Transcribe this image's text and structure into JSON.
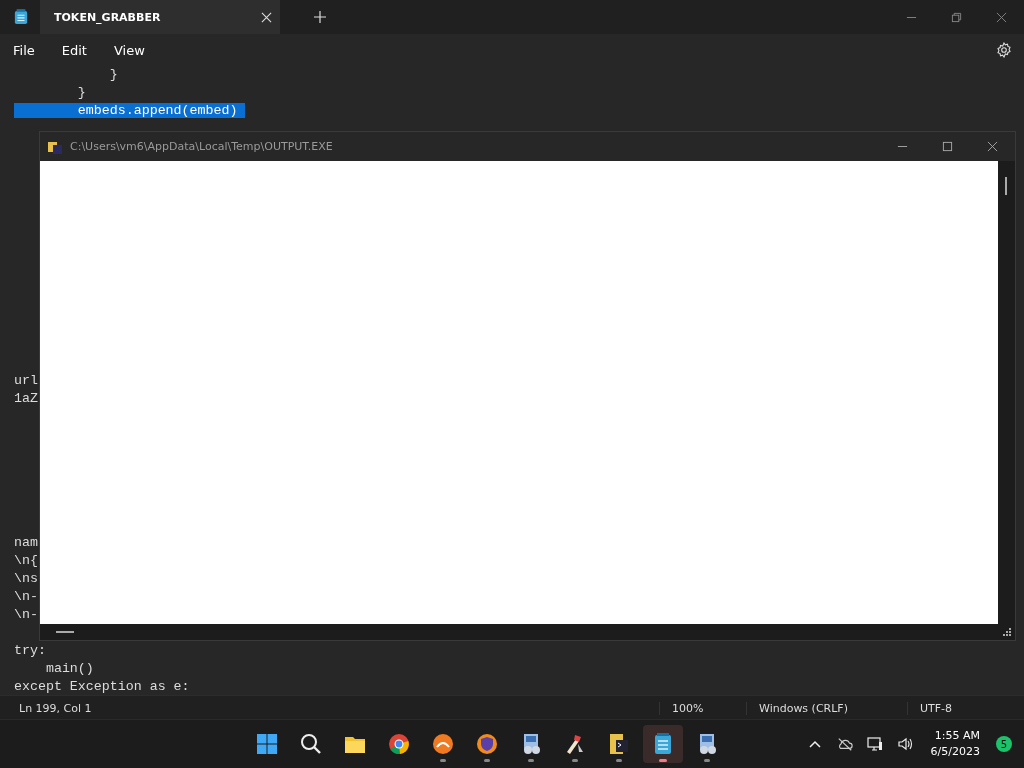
{
  "notepad": {
    "tabs": [
      {
        "title": "TOKEN_GRABBER",
        "selected": true
      }
    ],
    "menu": [
      "File",
      "Edit",
      "View"
    ],
    "editor_blocks": [
      [
        {
          "text": "            }",
          "selected": false
        },
        {
          "text": "        }",
          "selected": false
        },
        {
          "text": "        embeds.append(embed)",
          "selected": true
        }
      ],
      [
        {
          "text": "url",
          "selected": false
        },
        {
          "text": "1aZ",
          "selected": false
        }
      ],
      [
        {
          "text": "nam",
          "selected": false
        },
        {
          "text": "\\n{",
          "selected": false
        },
        {
          "text": "\\ns",
          "selected": false
        },
        {
          "text": "\\n-",
          "selected": false
        },
        {
          "text": "\\n-",
          "selected": false
        }
      ],
      [
        {
          "text": "try:",
          "selected": false
        },
        {
          "text": "    main()",
          "selected": false
        },
        {
          "text": "except Exception as e:",
          "selected": false
        }
      ]
    ],
    "status_bar": {
      "position": "Ln 199, Col 1",
      "zoom": "100%",
      "line_ending": "Windows (CRLF)",
      "encoding": "UTF-8"
    }
  },
  "console": {
    "title": "C:\\Users\\vm6\\AppData\\Local\\Temp\\OUTPUT.EXE"
  },
  "taskbar": {
    "apps": [
      {
        "kind": "start",
        "running": false,
        "selected": false
      },
      {
        "kind": "search",
        "running": false,
        "selected": false
      },
      {
        "kind": "folder",
        "running": false,
        "selected": false
      },
      {
        "kind": "browser",
        "running": false,
        "selected": false
      },
      {
        "kind": "app",
        "running": true,
        "selected": false
      },
      {
        "kind": "vpn",
        "running": true,
        "selected": false
      },
      {
        "kind": "setup",
        "running": true,
        "selected": false
      },
      {
        "kind": "tool",
        "running": true,
        "selected": false
      },
      {
        "kind": "console",
        "running": true,
        "selected": false
      },
      {
        "kind": "notepad",
        "running": true,
        "selected": true
      },
      {
        "kind": "setup",
        "running": true,
        "selected": false
      }
    ],
    "time": "1:55 AM",
    "date": "6/5/2023",
    "badge": "5"
  }
}
